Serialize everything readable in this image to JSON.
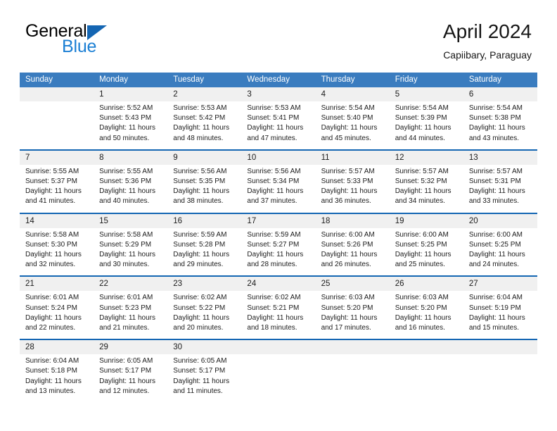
{
  "brand": {
    "name_part1": "General",
    "name_part2": "Blue",
    "accent_color": "#1466b3",
    "blue_text_color": "#1b7fd4"
  },
  "header": {
    "title": "April 2024",
    "subtitle": "Capiibary, Paraguay"
  },
  "theme": {
    "header_blue": "#3a7cbf",
    "separator_blue": "#1466b3",
    "daynum_band": "#f0f0f0",
    "text": "#1c1c1c"
  },
  "weekday_headers": [
    "Sunday",
    "Monday",
    "Tuesday",
    "Wednesday",
    "Thursday",
    "Friday",
    "Saturday"
  ],
  "labels": {
    "sunrise": "Sunrise:",
    "sunset": "Sunset:",
    "daylight": "Daylight:"
  },
  "weeks": [
    {
      "days": [
        {
          "num": "",
          "l1": "",
          "l2": "",
          "l3": "",
          "l4": ""
        },
        {
          "num": "1",
          "l1": "Sunrise: 5:52 AM",
          "l2": "Sunset: 5:43 PM",
          "l3": "Daylight: 11 hours",
          "l4": "and 50 minutes."
        },
        {
          "num": "2",
          "l1": "Sunrise: 5:53 AM",
          "l2": "Sunset: 5:42 PM",
          "l3": "Daylight: 11 hours",
          "l4": "and 48 minutes."
        },
        {
          "num": "3",
          "l1": "Sunrise: 5:53 AM",
          "l2": "Sunset: 5:41 PM",
          "l3": "Daylight: 11 hours",
          "l4": "and 47 minutes."
        },
        {
          "num": "4",
          "l1": "Sunrise: 5:54 AM",
          "l2": "Sunset: 5:40 PM",
          "l3": "Daylight: 11 hours",
          "l4": "and 45 minutes."
        },
        {
          "num": "5",
          "l1": "Sunrise: 5:54 AM",
          "l2": "Sunset: 5:39 PM",
          "l3": "Daylight: 11 hours",
          "l4": "and 44 minutes."
        },
        {
          "num": "6",
          "l1": "Sunrise: 5:54 AM",
          "l2": "Sunset: 5:38 PM",
          "l3": "Daylight: 11 hours",
          "l4": "and 43 minutes."
        }
      ]
    },
    {
      "days": [
        {
          "num": "7",
          "l1": "Sunrise: 5:55 AM",
          "l2": "Sunset: 5:37 PM",
          "l3": "Daylight: 11 hours",
          "l4": "and 41 minutes."
        },
        {
          "num": "8",
          "l1": "Sunrise: 5:55 AM",
          "l2": "Sunset: 5:36 PM",
          "l3": "Daylight: 11 hours",
          "l4": "and 40 minutes."
        },
        {
          "num": "9",
          "l1": "Sunrise: 5:56 AM",
          "l2": "Sunset: 5:35 PM",
          "l3": "Daylight: 11 hours",
          "l4": "and 38 minutes."
        },
        {
          "num": "10",
          "l1": "Sunrise: 5:56 AM",
          "l2": "Sunset: 5:34 PM",
          "l3": "Daylight: 11 hours",
          "l4": "and 37 minutes."
        },
        {
          "num": "11",
          "l1": "Sunrise: 5:57 AM",
          "l2": "Sunset: 5:33 PM",
          "l3": "Daylight: 11 hours",
          "l4": "and 36 minutes."
        },
        {
          "num": "12",
          "l1": "Sunrise: 5:57 AM",
          "l2": "Sunset: 5:32 PM",
          "l3": "Daylight: 11 hours",
          "l4": "and 34 minutes."
        },
        {
          "num": "13",
          "l1": "Sunrise: 5:57 AM",
          "l2": "Sunset: 5:31 PM",
          "l3": "Daylight: 11 hours",
          "l4": "and 33 minutes."
        }
      ]
    },
    {
      "days": [
        {
          "num": "14",
          "l1": "Sunrise: 5:58 AM",
          "l2": "Sunset: 5:30 PM",
          "l3": "Daylight: 11 hours",
          "l4": "and 32 minutes."
        },
        {
          "num": "15",
          "l1": "Sunrise: 5:58 AM",
          "l2": "Sunset: 5:29 PM",
          "l3": "Daylight: 11 hours",
          "l4": "and 30 minutes."
        },
        {
          "num": "16",
          "l1": "Sunrise: 5:59 AM",
          "l2": "Sunset: 5:28 PM",
          "l3": "Daylight: 11 hours",
          "l4": "and 29 minutes."
        },
        {
          "num": "17",
          "l1": "Sunrise: 5:59 AM",
          "l2": "Sunset: 5:27 PM",
          "l3": "Daylight: 11 hours",
          "l4": "and 28 minutes."
        },
        {
          "num": "18",
          "l1": "Sunrise: 6:00 AM",
          "l2": "Sunset: 5:26 PM",
          "l3": "Daylight: 11 hours",
          "l4": "and 26 minutes."
        },
        {
          "num": "19",
          "l1": "Sunrise: 6:00 AM",
          "l2": "Sunset: 5:25 PM",
          "l3": "Daylight: 11 hours",
          "l4": "and 25 minutes."
        },
        {
          "num": "20",
          "l1": "Sunrise: 6:00 AM",
          "l2": "Sunset: 5:25 PM",
          "l3": "Daylight: 11 hours",
          "l4": "and 24 minutes."
        }
      ]
    },
    {
      "days": [
        {
          "num": "21",
          "l1": "Sunrise: 6:01 AM",
          "l2": "Sunset: 5:24 PM",
          "l3": "Daylight: 11 hours",
          "l4": "and 22 minutes."
        },
        {
          "num": "22",
          "l1": "Sunrise: 6:01 AM",
          "l2": "Sunset: 5:23 PM",
          "l3": "Daylight: 11 hours",
          "l4": "and 21 minutes."
        },
        {
          "num": "23",
          "l1": "Sunrise: 6:02 AM",
          "l2": "Sunset: 5:22 PM",
          "l3": "Daylight: 11 hours",
          "l4": "and 20 minutes."
        },
        {
          "num": "24",
          "l1": "Sunrise: 6:02 AM",
          "l2": "Sunset: 5:21 PM",
          "l3": "Daylight: 11 hours",
          "l4": "and 18 minutes."
        },
        {
          "num": "25",
          "l1": "Sunrise: 6:03 AM",
          "l2": "Sunset: 5:20 PM",
          "l3": "Daylight: 11 hours",
          "l4": "and 17 minutes."
        },
        {
          "num": "26",
          "l1": "Sunrise: 6:03 AM",
          "l2": "Sunset: 5:20 PM",
          "l3": "Daylight: 11 hours",
          "l4": "and 16 minutes."
        },
        {
          "num": "27",
          "l1": "Sunrise: 6:04 AM",
          "l2": "Sunset: 5:19 PM",
          "l3": "Daylight: 11 hours",
          "l4": "and 15 minutes."
        }
      ]
    },
    {
      "days": [
        {
          "num": "28",
          "l1": "Sunrise: 6:04 AM",
          "l2": "Sunset: 5:18 PM",
          "l3": "Daylight: 11 hours",
          "l4": "and 13 minutes."
        },
        {
          "num": "29",
          "l1": "Sunrise: 6:05 AM",
          "l2": "Sunset: 5:17 PM",
          "l3": "Daylight: 11 hours",
          "l4": "and 12 minutes."
        },
        {
          "num": "30",
          "l1": "Sunrise: 6:05 AM",
          "l2": "Sunset: 5:17 PM",
          "l3": "Daylight: 11 hours",
          "l4": "and 11 minutes."
        },
        {
          "num": "",
          "l1": "",
          "l2": "",
          "l3": "",
          "l4": ""
        },
        {
          "num": "",
          "l1": "",
          "l2": "",
          "l3": "",
          "l4": ""
        },
        {
          "num": "",
          "l1": "",
          "l2": "",
          "l3": "",
          "l4": ""
        },
        {
          "num": "",
          "l1": "",
          "l2": "",
          "l3": "",
          "l4": ""
        }
      ]
    }
  ]
}
